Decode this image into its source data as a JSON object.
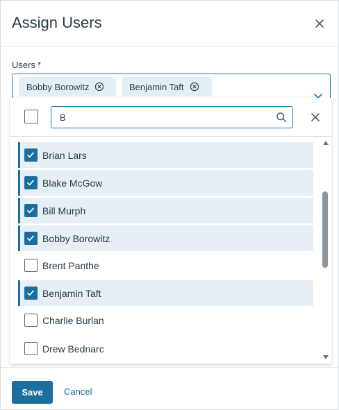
{
  "dialog": {
    "title": "Assign Users",
    "close_icon": "close-icon"
  },
  "users_field": {
    "label": "Users",
    "required_marker": "*",
    "chips": [
      {
        "label": "Bobby Borowitz",
        "remove_icon": "circle-x-icon"
      },
      {
        "label": "Benjamin Taft",
        "remove_icon": "circle-x-icon"
      }
    ],
    "toggle_icon": "chevron-down-icon"
  },
  "dropdown": {
    "search": {
      "value": "B",
      "icon": "search-icon"
    },
    "clear_icon": "close-icon",
    "items": [
      {
        "label": "Brian Lars",
        "checked": true
      },
      {
        "label": "Blake McGow",
        "checked": true
      },
      {
        "label": "Bill Murph",
        "checked": true
      },
      {
        "label": "Bobby Borowitz",
        "checked": true
      },
      {
        "label": "Brent Panthe",
        "checked": false
      },
      {
        "label": "Benjamin Taft",
        "checked": true
      },
      {
        "label": "Charlie Burlan",
        "checked": false
      },
      {
        "label": "Drew Bednarc",
        "checked": false
      }
    ]
  },
  "footer": {
    "save_label": "Save",
    "cancel_label": "Cancel"
  },
  "colors": {
    "accent": "#1b6f9e",
    "selected_row": "#e5eff5",
    "chip_bg": "#e4eff5"
  }
}
